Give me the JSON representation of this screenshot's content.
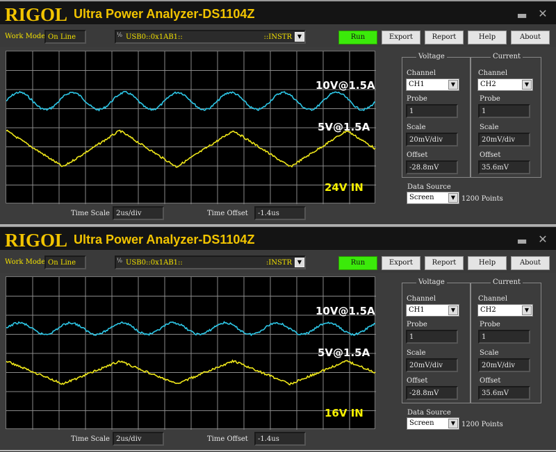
{
  "windows": [
    {
      "logo": "RIGOL",
      "title": "Ultra Power Analyzer-DS1104Z",
      "minimize_icon": "minimize-icon",
      "close_icon": "close-icon",
      "work_mode_label": "Work Mode",
      "work_mode_value": "On Line",
      "io_icon": "I/O",
      "resource_left": "USB0::0x1AB1::",
      "resource_right": "::INSTR",
      "buttons": {
        "run": "Run",
        "export": "Export",
        "report": "Report",
        "help": "Help",
        "about": "About"
      },
      "annotations": {
        "ch2": "10V@1.5A",
        "ch1": "5V@1.5A",
        "input": "24V IN"
      },
      "time_scale_label": "Time Scale",
      "time_scale_value": "2us/div",
      "time_offset_label": "Time Offset",
      "time_offset_value": "-1.4us",
      "voltage": {
        "title": "Voltage",
        "channel_label": "Channel",
        "channel": "CH1",
        "probe_label": "Probe",
        "probe": "1",
        "scale_label": "Scale",
        "scale": "20mV/div",
        "offset_label": "Offset",
        "offset": "-28.8mV"
      },
      "current": {
        "title": "Current",
        "channel_label": "Channel",
        "channel": "CH2",
        "probe_label": "Probe",
        "probe": "1",
        "scale_label": "Scale",
        "scale": "20mV/div",
        "offset_label": "Offset",
        "offset": "35.6mV"
      },
      "data_source_label": "Data Source",
      "data_source": "Screen",
      "points": "1200 Points",
      "traces": {
        "cyan": {
          "color": "#2ec8e8",
          "center_div": 2.6,
          "amp_div": 0.45,
          "period_div": 2.0,
          "shape": "sine"
        },
        "yellow": {
          "color": "#f0e81a",
          "center_div": 5.1,
          "amp_div": 0.95,
          "period_div": 4.3,
          "shape": "triangle"
        }
      }
    },
    {
      "logo": "RIGOL",
      "title": "Ultra Power Analyzer-DS1104Z",
      "minimize_icon": "minimize-icon",
      "close_icon": "close-icon",
      "work_mode_label": "Work Mode",
      "work_mode_value": "On Line",
      "io_icon": "I/O",
      "resource_left": "USB0::0x1AB1::",
      "resource_right": ":INSTR",
      "buttons": {
        "run": "Run",
        "export": "Export",
        "report": "Report",
        "help": "Help",
        "about": "About"
      },
      "annotations": {
        "ch2": "10V@1.5A",
        "ch1": "5V@1.5A",
        "input": "16V IN"
      },
      "time_scale_label": "Time Scale",
      "time_scale_value": "2us/div",
      "time_offset_label": "Time Offset",
      "time_offset_value": "-1.4us",
      "voltage": {
        "title": "Voltage",
        "channel_label": "Channel",
        "channel": "CH1",
        "probe_label": "Probe",
        "probe": "1",
        "scale_label": "Scale",
        "scale": "20mV/div",
        "offset_label": "Offset",
        "offset": "-28.8mV"
      },
      "current": {
        "title": "Current",
        "channel_label": "Channel",
        "channel": "CH2",
        "probe_label": "Probe",
        "probe": "1",
        "scale_label": "Scale",
        "scale": "20mV/div",
        "offset_label": "Offset",
        "offset": "35.6mV"
      },
      "data_source_label": "Data Source",
      "data_source": "Screen",
      "points": "1200 Points",
      "traces": {
        "cyan": {
          "color": "#2ec8e8",
          "center_div": 2.7,
          "amp_div": 0.3,
          "period_div": 1.95,
          "shape": "sine"
        },
        "yellow": {
          "color": "#f0e81a",
          "center_div": 5.0,
          "amp_div": 0.6,
          "period_div": 4.3,
          "shape": "triangle"
        }
      }
    }
  ]
}
